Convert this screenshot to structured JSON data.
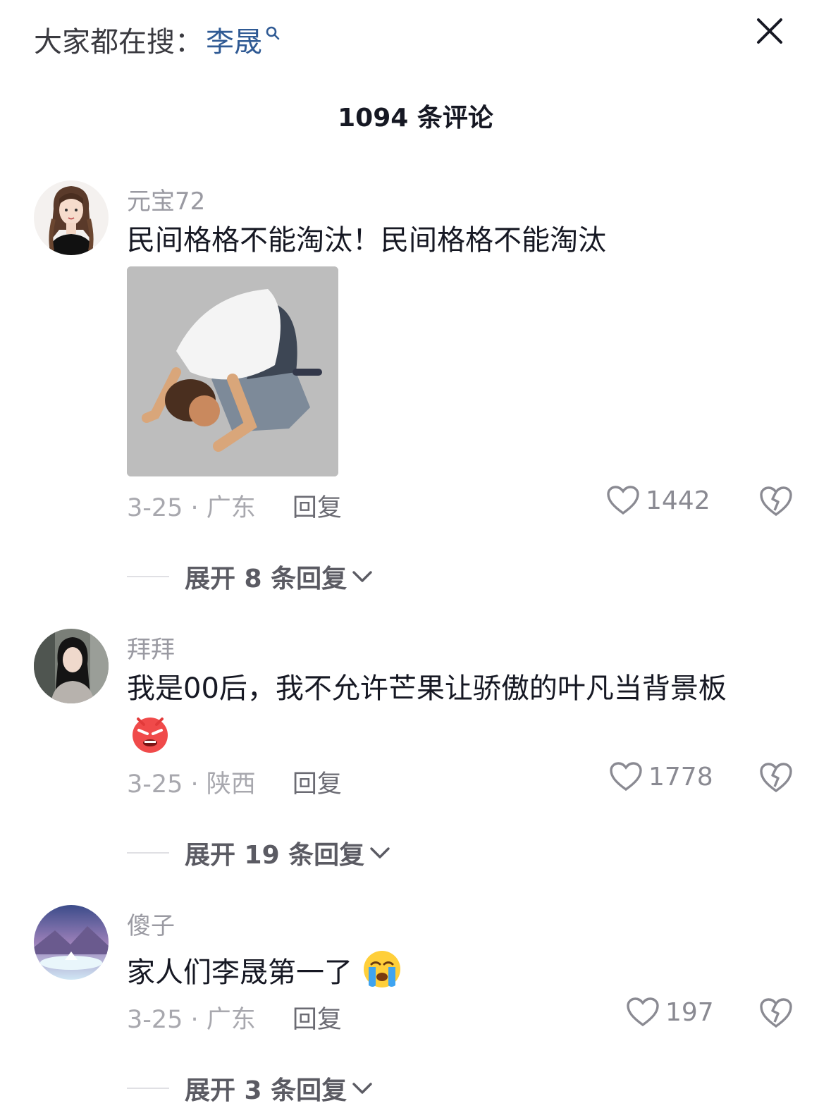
{
  "header": {
    "search_prefix": "大家都在搜：",
    "search_keyword": "李晟",
    "comment_count": "1094 条评论"
  },
  "comments": [
    {
      "username": "元宝72",
      "text": "民间格格不能淘汰！民间格格不能淘汰",
      "date_location": "3-25 · 广东",
      "reply_label": "回复",
      "likes": "1442",
      "expand_label": "展开 8 条回复",
      "has_image": true
    },
    {
      "username": "拜拜",
      "text": "我是00后，我不允许芒果让骄傲的叶凡当背景板",
      "emoji": "angry-face",
      "date_location": "3-25 · 陕西",
      "reply_label": "回复",
      "likes": "1778",
      "expand_label": "展开 19 条回复"
    },
    {
      "username": "傻子",
      "text": "家人们李晟第一了",
      "emoji": "crying-face",
      "date_location": "3-25 · 广东",
      "reply_label": "回复",
      "likes": "197",
      "expand_label": "展开 3 条回复"
    }
  ],
  "icons": {
    "close": "close-icon",
    "search": "search-icon",
    "like": "heart-icon",
    "dislike": "broken-heart-icon",
    "expand": "chevron-down-icon"
  },
  "colors": {
    "keyword": "#2f5a94",
    "meta": "#a8a8ae",
    "text": "#161823"
  }
}
